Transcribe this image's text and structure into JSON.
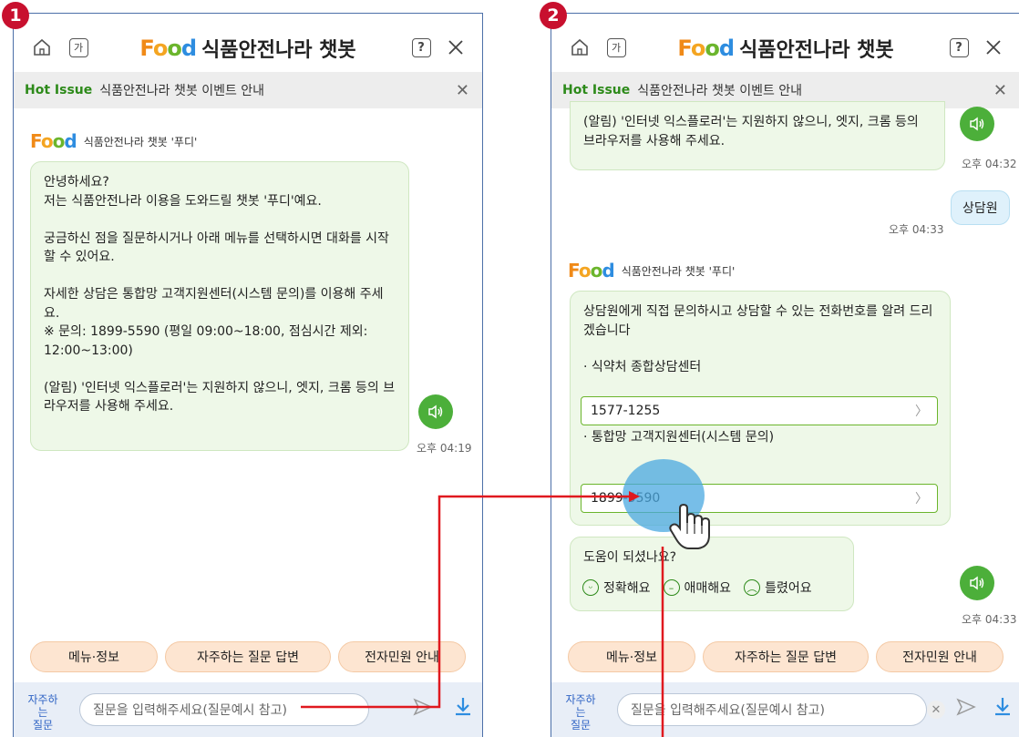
{
  "steps": [
    "1",
    "2"
  ],
  "header": {
    "brand_logo": "Food",
    "brand_title": "식품안전나라 챗봇",
    "font_btn": "가",
    "help_btn": "?"
  },
  "hot_issue": {
    "tag": "Hot Issue",
    "text": "식품안전나라 챗봇 이벤트 안내"
  },
  "bot_name": "식품안전나라 챗봇 '푸디'",
  "panel1": {
    "greeting": "안녕하세요?\n저는 식품안전나라 이용을 도와드릴 챗봇 '푸디'예요.\n\n궁금하신 점을 질문하시거나 아래 메뉴를 선택하시면 대화를 시작할 수 있어요.\n\n자세한 상담은 통합망 고객지원센터(시스템 문의)를 이용해 주세요.\n※ 문의: 1899-5590 (평일 09:00~18:00, 점심시간 제외: 12:00~13:00)\n\n(알림) '인터넷 익스플로러'는 지원하지 않으니, 엣지, 크롬 등의 브라우저를 사용해 주세요.",
    "time": "오후 04:19"
  },
  "panel2": {
    "prev_message": "(알림) '인터넷 익스플로러'는 지원하지 않으니, 엣지, 크롬 등의 브라우저를 사용해 주세요.",
    "prev_time": "오후 04:32",
    "user_message": "상담원",
    "user_time": "오후 04:33",
    "answer_intro": "상담원에게 직접 문의하시고 상담할 수 있는 전화번호를 알려 드리겠습니다",
    "center1_label": "· 식약처 종합상담센터",
    "center1_phone": "1577-1255",
    "center2_label": "· 통합망 고객지원센터(시스템 문의)",
    "center2_phone": "1899-5590",
    "feedback_q": "도움이 되셨나요?",
    "feedback": [
      "정확해요",
      "애매해요",
      "틀렸어요"
    ],
    "answer_time": "오후 04:33"
  },
  "quick_menu": [
    "메뉴·정보",
    "자주하는 질문 답변",
    "전자민원 안내"
  ],
  "input": {
    "faq_label_1": "자주하는",
    "faq_label_2": "질문",
    "placeholder": "질문을 입력해주세요(질문예시 참고)"
  },
  "colors": {
    "accent_green": "#4caf3a",
    "badge_red": "#c8102e",
    "link_blue": "#2e63c4",
    "annotation_red": "#e0191f"
  }
}
